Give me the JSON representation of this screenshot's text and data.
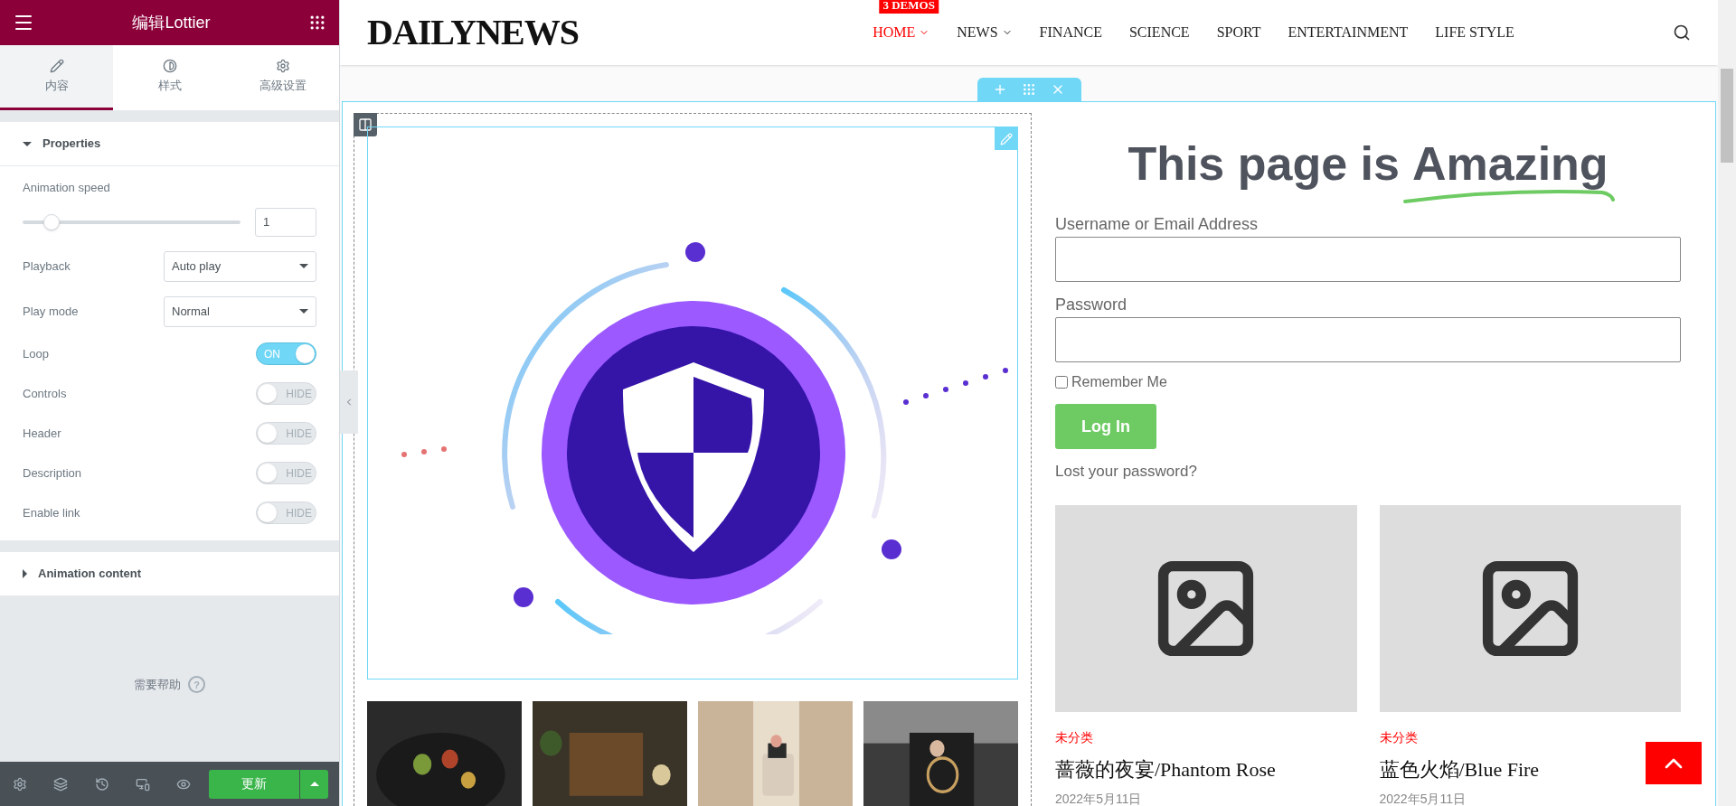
{
  "panel": {
    "title": "编辑Lottier",
    "tabs": [
      {
        "label": "内容",
        "selected": true
      },
      {
        "label": "样式",
        "selected": false
      },
      {
        "label": "高级设置",
        "selected": false
      }
    ],
    "sections": [
      {
        "title": "Properties",
        "expanded": true,
        "controls": [
          {
            "kind": "slider",
            "label": "Animation speed",
            "level": 0.1,
            "value": "1"
          },
          {
            "kind": "select",
            "label": "Playback",
            "value": "Auto play"
          },
          {
            "kind": "select",
            "label": "Play mode",
            "value": "Normal"
          },
          {
            "kind": "switch",
            "label": "Loop",
            "on": true,
            "text": "ON"
          },
          {
            "kind": "switch",
            "label": "Controls",
            "on": false,
            "text": "HIDE"
          },
          {
            "kind": "switch",
            "label": "Header",
            "on": false,
            "text": "HIDE"
          },
          {
            "kind": "switch",
            "label": "Description",
            "on": false,
            "text": "HIDE"
          },
          {
            "kind": "switch",
            "label": "Enable link",
            "on": false,
            "text": "HIDE"
          }
        ]
      },
      {
        "title": "Animation content",
        "expanded": false
      }
    ],
    "help": "需要帮助",
    "help_icon": "?",
    "update": "更新"
  },
  "site": {
    "logo": "DAILYNEWS",
    "nav": [
      {
        "label": "HOME",
        "selected": true,
        "dropdown": true,
        "badge": "3 DEMOS"
      },
      {
        "label": "NEWS",
        "selected": false,
        "dropdown": true
      },
      {
        "label": "FINANCE",
        "selected": false,
        "dropdown": false
      },
      {
        "label": "SCIENCE",
        "selected": false,
        "dropdown": false
      },
      {
        "label": "SPORT",
        "selected": false,
        "dropdown": false
      },
      {
        "label": "ENTERTAINMENT",
        "selected": false,
        "dropdown": false
      },
      {
        "label": "LIFE STYLE",
        "selected": false,
        "dropdown": false
      }
    ]
  },
  "login": {
    "heading": "This page is",
    "highlight": "Amazing",
    "username_label": "Username or Email Address",
    "password_label": "Password",
    "remember": {
      "label": "Remember Me",
      "checked": false
    },
    "button": "Log In",
    "lost": "Lost your password?"
  },
  "posts": [
    {
      "category": "未分类",
      "title": "蔷薇的夜宴/Phantom Rose",
      "date": "2022年5月11日"
    },
    {
      "category": "未分类",
      "title": "蓝色火焰/Blue Fire",
      "date": "2022年5月11日"
    }
  ]
}
